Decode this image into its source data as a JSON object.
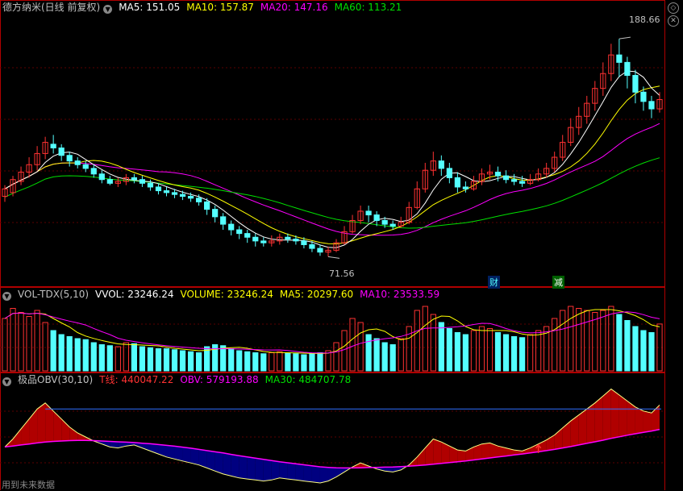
{
  "main_legend": {
    "title": "德方纳米(日线 前复权)",
    "ma5_label": "MA5: 151.05",
    "ma10_label": "MA10: 157.87",
    "ma20_label": "MA20: 147.16",
    "ma60_label": "MA60: 113.21"
  },
  "vol_legend": {
    "title": "VOL-TDX(5,10)",
    "vvol_label": "VVOL: 23246.24",
    "volume_label": "VOLUME: 23246.24",
    "ma5_label": "MA5: 20297.60",
    "ma10_label": "MA10: 23533.59"
  },
  "obv_legend": {
    "title": "极品OBV(30,10)",
    "t_label": "T线: 440047.22",
    "obv_label": "OBV: 579193.88",
    "ma30_label": "MA30: 484707.78"
  },
  "annotations": {
    "high_label": "188.66",
    "low_label": "71.56",
    "marker_cai": "财",
    "marker_jian": "减"
  },
  "footer_text": "用到未来数据",
  "colors": {
    "up": "#ff3232",
    "down": "#54ffff",
    "ma5": "#ffffff",
    "ma10": "#ffff00",
    "ma20": "#ff00ff",
    "ma60": "#00e000",
    "obv_fill_up": "#b00000",
    "obv_fill_down": "#000080",
    "obv_ref_line": "#3070ff"
  },
  "chart_data": [
    {
      "type": "candlestick",
      "title": "德方纳米(日线 前复权)",
      "price_range": [
        60,
        200
      ],
      "highest": 188.66,
      "lowest": 71.56,
      "candles": [
        [
          104,
          108,
          101,
          110
        ],
        [
          106,
          113,
          104,
          115
        ],
        [
          112,
          117,
          110,
          120
        ],
        [
          117,
          121,
          114,
          125
        ],
        [
          121,
          127,
          118,
          131
        ],
        [
          127,
          133,
          124,
          136
        ],
        [
          132,
          130,
          127,
          137
        ],
        [
          130,
          126,
          123,
          132
        ],
        [
          126,
          123,
          120,
          128
        ],
        [
          123,
          121,
          119,
          125
        ],
        [
          121,
          119,
          117,
          123
        ],
        [
          119,
          116,
          114,
          121
        ],
        [
          116,
          113,
          111,
          118
        ],
        [
          113,
          111,
          110,
          115
        ],
        [
          111,
          112,
          109,
          114
        ],
        [
          112,
          114,
          110,
          116
        ],
        [
          114,
          113,
          111,
          116
        ],
        [
          113,
          111,
          109,
          115
        ],
        [
          111,
          109,
          107,
          113
        ],
        [
          109,
          107,
          105,
          111
        ],
        [
          107,
          106,
          104,
          109
        ],
        [
          106,
          105,
          103,
          108
        ],
        [
          105,
          104,
          102,
          107
        ],
        [
          104,
          103,
          101,
          106
        ],
        [
          103,
          101,
          99,
          105
        ],
        [
          101,
          97,
          94,
          103
        ],
        [
          97,
          93,
          90,
          99
        ],
        [
          93,
          89,
          86,
          95
        ],
        [
          89,
          86,
          83,
          91
        ],
        [
          86,
          84,
          81,
          88
        ],
        [
          84,
          82,
          79,
          86
        ],
        [
          82,
          80,
          77,
          84
        ],
        [
          80,
          79,
          77,
          82
        ],
        [
          79,
          80,
          77,
          83
        ],
        [
          80,
          82,
          78,
          84
        ],
        [
          82,
          81,
          79,
          84
        ],
        [
          81,
          80,
          78,
          83
        ],
        [
          80,
          78,
          76,
          82
        ],
        [
          78,
          76,
          74,
          80
        ],
        [
          76,
          74,
          72,
          78
        ],
        [
          74,
          75,
          71.56,
          77
        ],
        [
          75,
          79,
          74,
          81
        ],
        [
          79,
          85,
          78,
          88
        ],
        [
          85,
          91,
          84,
          94
        ],
        [
          91,
          96,
          89,
          99
        ],
        [
          96,
          94,
          90,
          99
        ],
        [
          94,
          91,
          88,
          96
        ],
        [
          91,
          89,
          87,
          93
        ],
        [
          89,
          88,
          86,
          91
        ],
        [
          88,
          90,
          87,
          93
        ],
        [
          90,
          98,
          89,
          101
        ],
        [
          98,
          108,
          97,
          112
        ],
        [
          108,
          118,
          106,
          122
        ],
        [
          118,
          123,
          115,
          128
        ],
        [
          123,
          119,
          115,
          126
        ],
        [
          119,
          114,
          111,
          122
        ],
        [
          114,
          109,
          106,
          117
        ],
        [
          109,
          108,
          106,
          112
        ],
        [
          108,
          112,
          107,
          115
        ],
        [
          112,
          116,
          110,
          119
        ],
        [
          116,
          117,
          113,
          121
        ],
        [
          117,
          115,
          112,
          120
        ],
        [
          115,
          113,
          111,
          118
        ],
        [
          113,
          112,
          110,
          116
        ],
        [
          112,
          111,
          109,
          115
        ],
        [
          111,
          113,
          110,
          116
        ],
        [
          113,
          116,
          112,
          119
        ],
        [
          116,
          119,
          114,
          122
        ],
        [
          119,
          125,
          117,
          128
        ],
        [
          125,
          133,
          123,
          137
        ],
        [
          133,
          141,
          131,
          146
        ],
        [
          141,
          147,
          137,
          152
        ],
        [
          147,
          154,
          143,
          158
        ],
        [
          154,
          162,
          150,
          166
        ],
        [
          162,
          170,
          158,
          176
        ],
        [
          170,
          180,
          166,
          186
        ],
        [
          180,
          176,
          168,
          188.66
        ],
        [
          176,
          169,
          162,
          179
        ],
        [
          169,
          160,
          154,
          172
        ],
        [
          160,
          155,
          150,
          163
        ],
        [
          155,
          151,
          146,
          158
        ],
        [
          151,
          156,
          149,
          160
        ]
      ]
    },
    {
      "type": "bar",
      "title": "VOL-TDX(5,10)",
      "series_names": [
        "VOLUME",
        "MA5",
        "MA10"
      ],
      "values": [
        26000,
        31000,
        29000,
        27000,
        30000,
        24000,
        20000,
        18000,
        17000,
        16000,
        15500,
        14000,
        13000,
        12500,
        12000,
        14000,
        13500,
        12000,
        11500,
        11000,
        11000,
        10500,
        10000,
        9500,
        9000,
        12000,
        13000,
        12500,
        11000,
        10000,
        9500,
        9000,
        8500,
        9000,
        9500,
        9000,
        8500,
        8000,
        8500,
        9000,
        10000,
        14000,
        20000,
        26000,
        24000,
        18000,
        16000,
        14000,
        13000,
        16000,
        22000,
        30000,
        32000,
        28000,
        24000,
        21000,
        19000,
        18000,
        20000,
        22000,
        21000,
        19000,
        18000,
        17000,
        16500,
        18000,
        20000,
        22000,
        26000,
        30000,
        32000,
        31000,
        30000,
        29000,
        30000,
        32000,
        28000,
        25000,
        22000,
        20000,
        19000,
        23246.24
      ],
      "ma5_last": 20297.6,
      "ma10_last": 23533.59
    },
    {
      "type": "area",
      "title": "极品OBV(30,10)",
      "series_names": [
        "OBV",
        "MA30",
        "T线"
      ],
      "obv_last": 579193.88,
      "ma30_last": 484707.78,
      "t_last": 440047.22,
      "values": [
        200,
        240,
        290,
        340,
        390,
        420,
        380,
        340,
        300,
        270,
        250,
        230,
        215,
        200,
        195,
        205,
        210,
        195,
        180,
        165,
        150,
        140,
        130,
        120,
        110,
        95,
        80,
        65,
        55,
        45,
        40,
        35,
        30,
        35,
        45,
        40,
        35,
        30,
        25,
        20,
        30,
        50,
        75,
        100,
        120,
        105,
        90,
        80,
        75,
        85,
        110,
        150,
        195,
        240,
        225,
        205,
        185,
        180,
        200,
        215,
        220,
        205,
        195,
        185,
        180,
        195,
        215,
        235,
        260,
        295,
        330,
        360,
        390,
        420,
        455,
        490,
        460,
        430,
        400,
        380,
        370,
        410
      ],
      "ma30": [
        200,
        205,
        210,
        215,
        220,
        225,
        228,
        230,
        232,
        233,
        233,
        232,
        230,
        228,
        226,
        224,
        222,
        219,
        216,
        212,
        208,
        204,
        199,
        194,
        188,
        182,
        176,
        170,
        163,
        156,
        150,
        144,
        138,
        132,
        126,
        121,
        116,
        111,
        106,
        101,
        98,
        96,
        95,
        95,
        96,
        97,
        98,
        99,
        100,
        102,
        104,
        107,
        110,
        114,
        118,
        122,
        126,
        130,
        135,
        140,
        145,
        150,
        155,
        160,
        165,
        170,
        176,
        182,
        188,
        195,
        202,
        210,
        218,
        226,
        234,
        243,
        251,
        259,
        266,
        273,
        280,
        288
      ],
      "reference_line": 390
    }
  ]
}
